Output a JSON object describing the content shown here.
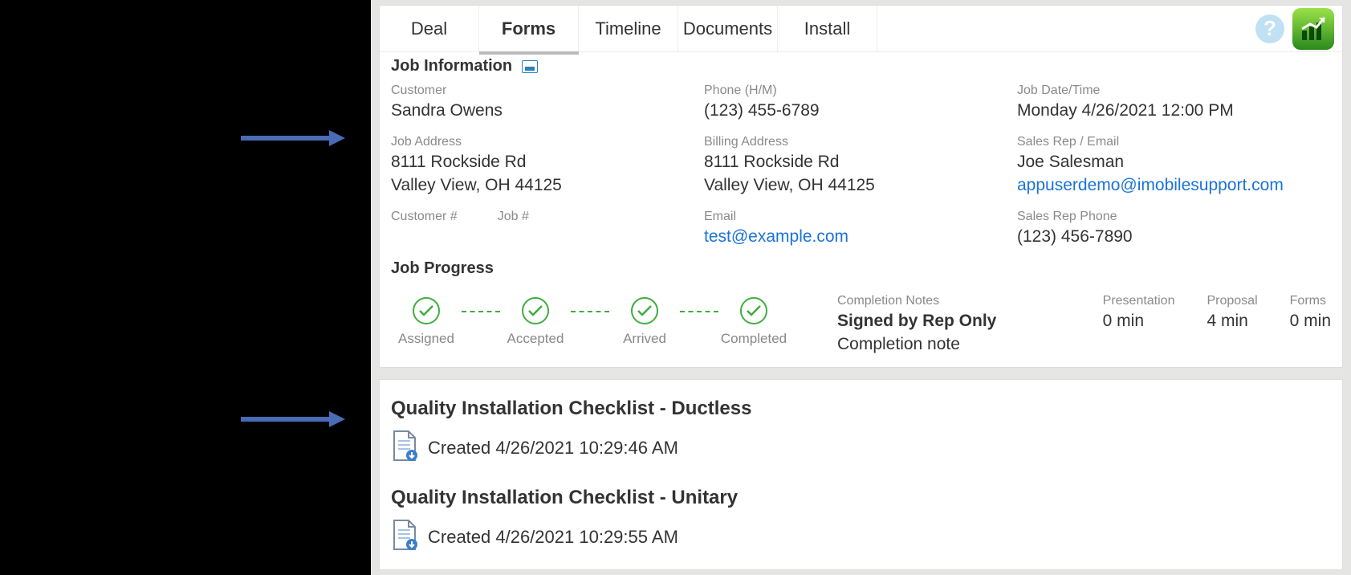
{
  "tabs": [
    {
      "label": "Deal",
      "active": false
    },
    {
      "label": "Forms",
      "active": true
    },
    {
      "label": "Timeline",
      "active": false
    },
    {
      "label": "Documents",
      "active": false
    },
    {
      "label": "Install",
      "active": false
    }
  ],
  "sections": {
    "jobInfoTitle": "Job Information",
    "jobProgressTitle": "Job Progress"
  },
  "customer": {
    "label": "Customer",
    "value": "Sandra Owens"
  },
  "phone": {
    "label": "Phone (H/M)",
    "value": "(123) 455-6789"
  },
  "jobDate": {
    "label": "Job Date/Time",
    "value": "Monday 4/26/2021 12:00 PM"
  },
  "jobAddress": {
    "label": "Job Address",
    "line1": "8111 Rockside Rd",
    "line2": "Valley View, OH 44125"
  },
  "billingAddress": {
    "label": "Billing Address",
    "line1": "8111 Rockside Rd",
    "line2": "Valley View, OH 44125"
  },
  "salesRep": {
    "label": "Sales Rep / Email",
    "name": "Joe Salesman",
    "email": "appuserdemo@imobilesupport.com"
  },
  "customerNum": {
    "label": "Customer #",
    "value": ""
  },
  "jobNum": {
    "label": "Job #",
    "value": ""
  },
  "email": {
    "label": "Email",
    "value": "test@example.com"
  },
  "salesRepPhone": {
    "label": "Sales Rep Phone",
    "value": "(123) 456-7890"
  },
  "steps": [
    {
      "label": "Assigned"
    },
    {
      "label": "Accepted"
    },
    {
      "label": "Arrived"
    },
    {
      "label": "Completed"
    }
  ],
  "completionNotes": {
    "label": "Completion Notes",
    "status": "Signed by Rep Only",
    "note": "Completion note"
  },
  "timing": {
    "presentation": {
      "label": "Presentation",
      "value": "0 min"
    },
    "proposal": {
      "label": "Proposal",
      "value": "4 min"
    },
    "forms": {
      "label": "Forms",
      "value": "0 min"
    }
  },
  "formsList": [
    {
      "title": "Quality Installation Checklist - Ductless",
      "created": "Created 4/26/2021 10:29:46 AM"
    },
    {
      "title": "Quality Installation Checklist - Unitary",
      "created": "Created 4/26/2021 10:29:55 AM"
    }
  ]
}
